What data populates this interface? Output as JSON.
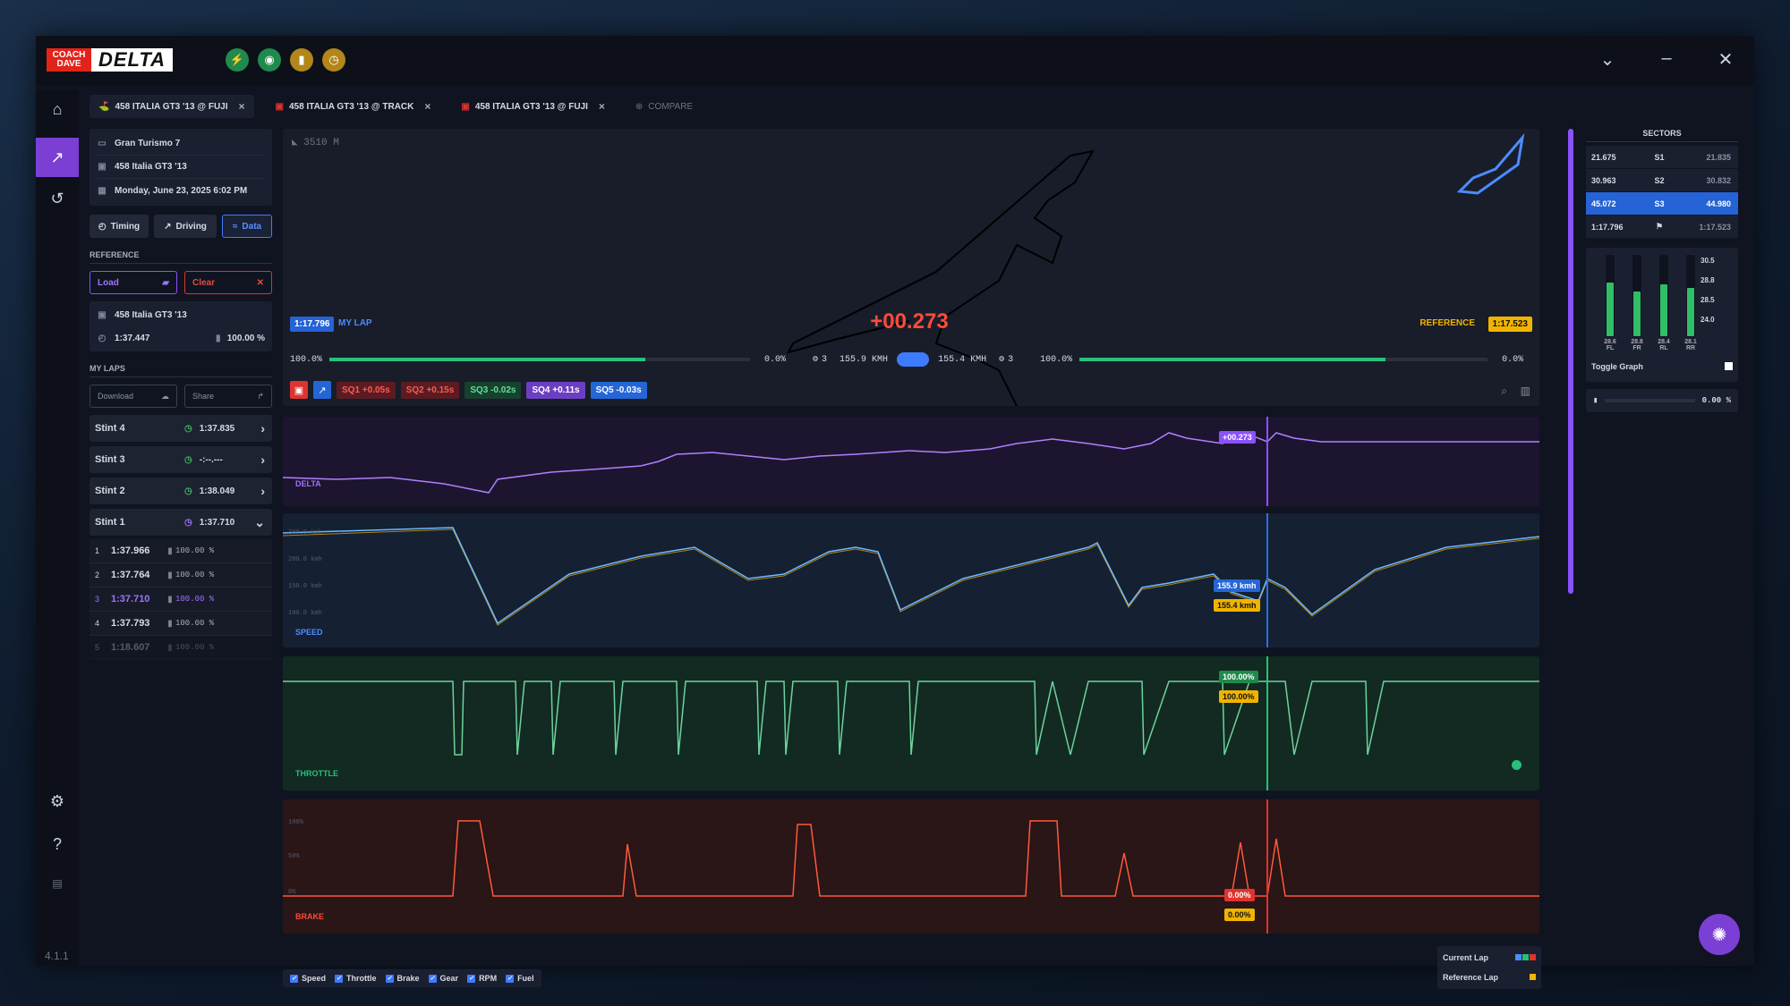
{
  "app": {
    "brand_top": "COACH DAVE",
    "brand_main": "DELTA",
    "version": "4.1.1"
  },
  "tabs": [
    {
      "label": "458 ITALIA GT3 '13 @ FUJI",
      "icon": "track-icon",
      "color": "#27c179"
    },
    {
      "label": "458 ITALIA GT3 '13 @ TRACK",
      "icon": "car-icon",
      "color": "#e0322e"
    },
    {
      "label": "458 ITALIA GT3 '13 @ FUJI",
      "icon": "car-icon",
      "color": "#e0322e"
    }
  ],
  "compare_label": "COMPARE",
  "session": {
    "game": "Gran Turismo 7",
    "car": "458 Italia GT3 '13",
    "date": "Monday, June 23, 2025 6:02 PM"
  },
  "modes": {
    "timing": "Timing",
    "driving": "Driving",
    "data": "Data"
  },
  "reference": {
    "title": "REFERENCE",
    "load": "Load",
    "clear": "Clear",
    "car": "458 Italia GT3 '13",
    "time": "1:37.447",
    "fuel": "100.00 %"
  },
  "my_laps": {
    "title": "MY LAPS",
    "download": "Download",
    "share": "Share",
    "stints": [
      {
        "name": "Stint 4",
        "time": "1:37.835",
        "arrow": "›"
      },
      {
        "name": "Stint 3",
        "time": "-:--.---",
        "arrow": "›"
      },
      {
        "name": "Stint 2",
        "time": "1:38.049",
        "arrow": "›"
      },
      {
        "name": "Stint 1",
        "time": "1:37.710",
        "arrow": "⌄"
      }
    ],
    "laps": [
      {
        "n": "1",
        "time": "1:37.966",
        "fuel": "100.00 %"
      },
      {
        "n": "2",
        "time": "1:37.764",
        "fuel": "100.00 %"
      },
      {
        "n": "3",
        "time": "1:37.710",
        "fuel": "100.00 %"
      },
      {
        "n": "4",
        "time": "1:37.793",
        "fuel": "100.00 %"
      },
      {
        "n": "5",
        "time": "1:18.607",
        "fuel": "100.00 %"
      }
    ]
  },
  "track": {
    "distance": "3510 M",
    "my_lap_time": "1:17.796",
    "my_lap_label": "MY LAP",
    "delta": "+00.273",
    "reference_label": "REFERENCE",
    "reference_time": "1:17.523",
    "left_throttle": "100.0%",
    "left_brake": "0.0%",
    "left_gear": "3",
    "left_speed": "155.9 KMH",
    "right_speed": "155.4 KMH",
    "right_gear": "3",
    "right_throttle": "100.0%",
    "right_brake": "0.0%",
    "left_throttle_fill": 0.75,
    "right_throttle_fill": 0.75
  },
  "sector_deltas": [
    {
      "label": "SQ1 +0.05s",
      "style": "red"
    },
    {
      "label": "SQ2 +0.15s",
      "style": "red"
    },
    {
      "label": "SQ3 -0.02s",
      "style": "green"
    },
    {
      "label": "SQ4 +0.11s",
      "style": "purple"
    },
    {
      "label": "SQ5 -0.03s",
      "style": "blue"
    }
  ],
  "charts": {
    "delta": {
      "label": "DELTA",
      "value": "+00.273"
    },
    "speed": {
      "label": "SPEED",
      "current": "155.9 kmh",
      "reference": "155.4 kmh",
      "yticks": [
        "300.0 kmh",
        "200.0 kmh",
        "150.0 kmh",
        "100.0 kmh"
      ]
    },
    "throttle": {
      "label": "THROTTLE",
      "current": "100.00%",
      "reference": "100.00%"
    },
    "brake": {
      "label": "BRAKE",
      "current": "0.00%",
      "reference": "0.00%",
      "yticks": [
        "100%",
        "50%",
        "0%"
      ]
    }
  },
  "legend": [
    "Speed",
    "Throttle",
    "Brake",
    "Gear",
    "RPM",
    "Fuel"
  ],
  "lap_legend": {
    "current": "Current Lap",
    "reference": "Reference Lap"
  },
  "sectors": {
    "title": "SECTORS",
    "rows": [
      {
        "mine": "21.675",
        "label": "S1",
        "ref": "21.835"
      },
      {
        "mine": "30.963",
        "label": "S2",
        "ref": "30.832"
      },
      {
        "mine": "45.072",
        "label": "S3",
        "ref": "44.980"
      },
      {
        "mine": "1:17.796",
        "label": "⚑",
        "ref": "1:17.523"
      }
    ]
  },
  "tyres": {
    "labels": [
      "FL",
      "FR",
      "RL",
      "RR"
    ],
    "values": [
      "28.6",
      "28.8",
      "28.4",
      "28.1"
    ],
    "scale": [
      "30.5",
      "28.8",
      "28.5",
      "24.0"
    ],
    "toggle_label": "Toggle Graph"
  },
  "fuel_pct": "0.00 %"
}
